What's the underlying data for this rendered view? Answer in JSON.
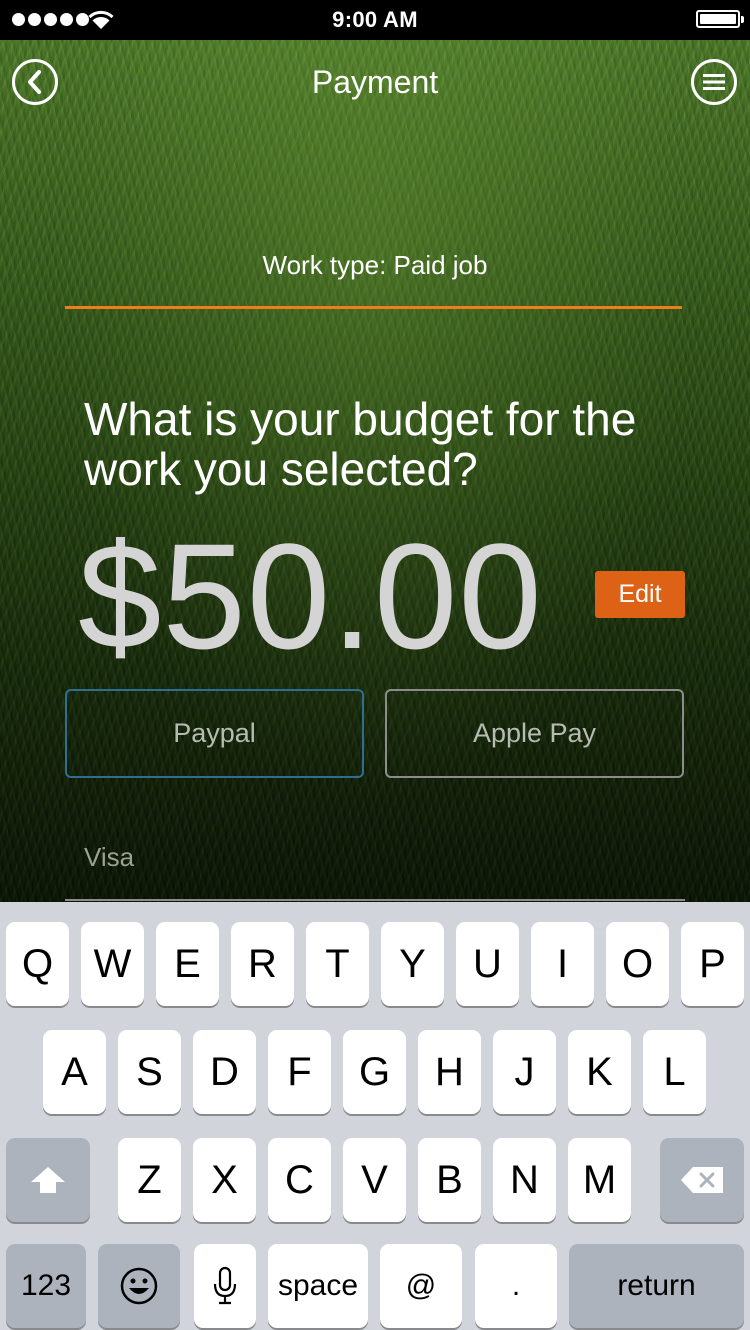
{
  "status_bar": {
    "time": "9:00 AM"
  },
  "header": {
    "title": "Payment"
  },
  "work_type": "Work type: Paid job",
  "question": "What is your budget for the work you selected?",
  "amount": "$50.00",
  "edit_label": "Edit",
  "payment_options": {
    "paypal": "Paypal",
    "apple_pay": "Apple Pay"
  },
  "visa_label": "Visa",
  "colors": {
    "accent_orange": "#de6215",
    "underline_orange": "#f07c1a",
    "paypal_border": "#2f6d92",
    "keyboard_bg": "#d1d5db"
  },
  "keyboard": {
    "row1": [
      "Q",
      "W",
      "E",
      "R",
      "T",
      "Y",
      "U",
      "I",
      "O",
      "P"
    ],
    "row2": [
      "A",
      "S",
      "D",
      "F",
      "G",
      "H",
      "J",
      "K",
      "L"
    ],
    "row3": [
      "Z",
      "X",
      "C",
      "V",
      "B",
      "N",
      "M"
    ],
    "numbers_key": "123",
    "space_key": "space",
    "at_key": "@",
    "period_key": ".",
    "return_key": "return"
  }
}
